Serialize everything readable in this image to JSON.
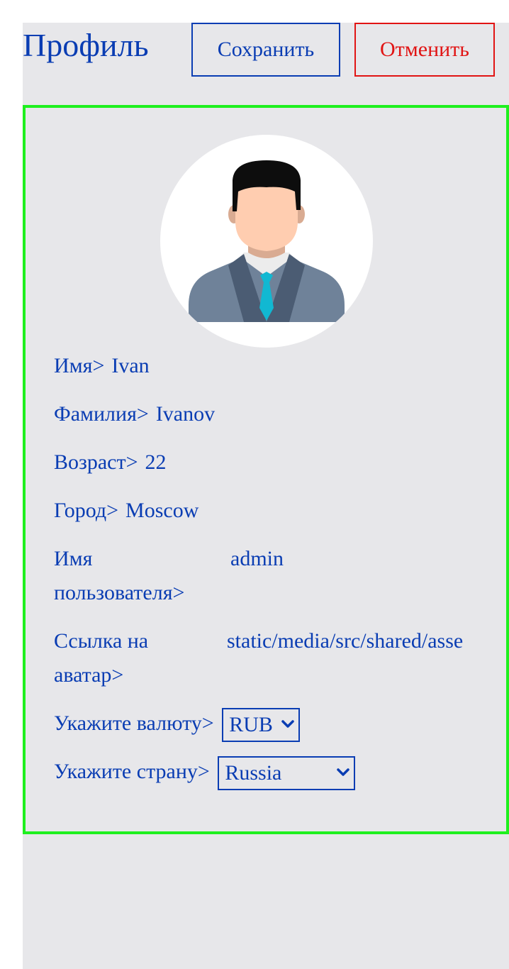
{
  "header": {
    "title": "Профиль",
    "save_label": "Сохранить",
    "cancel_label": "Отменить"
  },
  "profile": {
    "fields": [
      {
        "label": "Имя>",
        "value": "Ivan"
      },
      {
        "label": "Фамилия>",
        "value": "Ivanov"
      },
      {
        "label": "Возраст>",
        "value": "22"
      },
      {
        "label": "Город>",
        "value": "Moscow"
      },
      {
        "label": "Имя пользователя>",
        "value": "admin"
      },
      {
        "label": "Ссылка на аватар>",
        "value": "static/media/src/shared/asse"
      }
    ],
    "currency": {
      "label": "Укажите валюту>",
      "selected": "RUB"
    },
    "country": {
      "label": "Укажите страну>",
      "selected": "Russia"
    }
  },
  "colors": {
    "accent": "#0a3db3",
    "danger": "#e11414",
    "card_border": "#1ef01e",
    "background": "#e7e7ea"
  },
  "icons": {
    "avatar": "user-avatar-icon",
    "select_arrow": "chevron-down-icon"
  }
}
